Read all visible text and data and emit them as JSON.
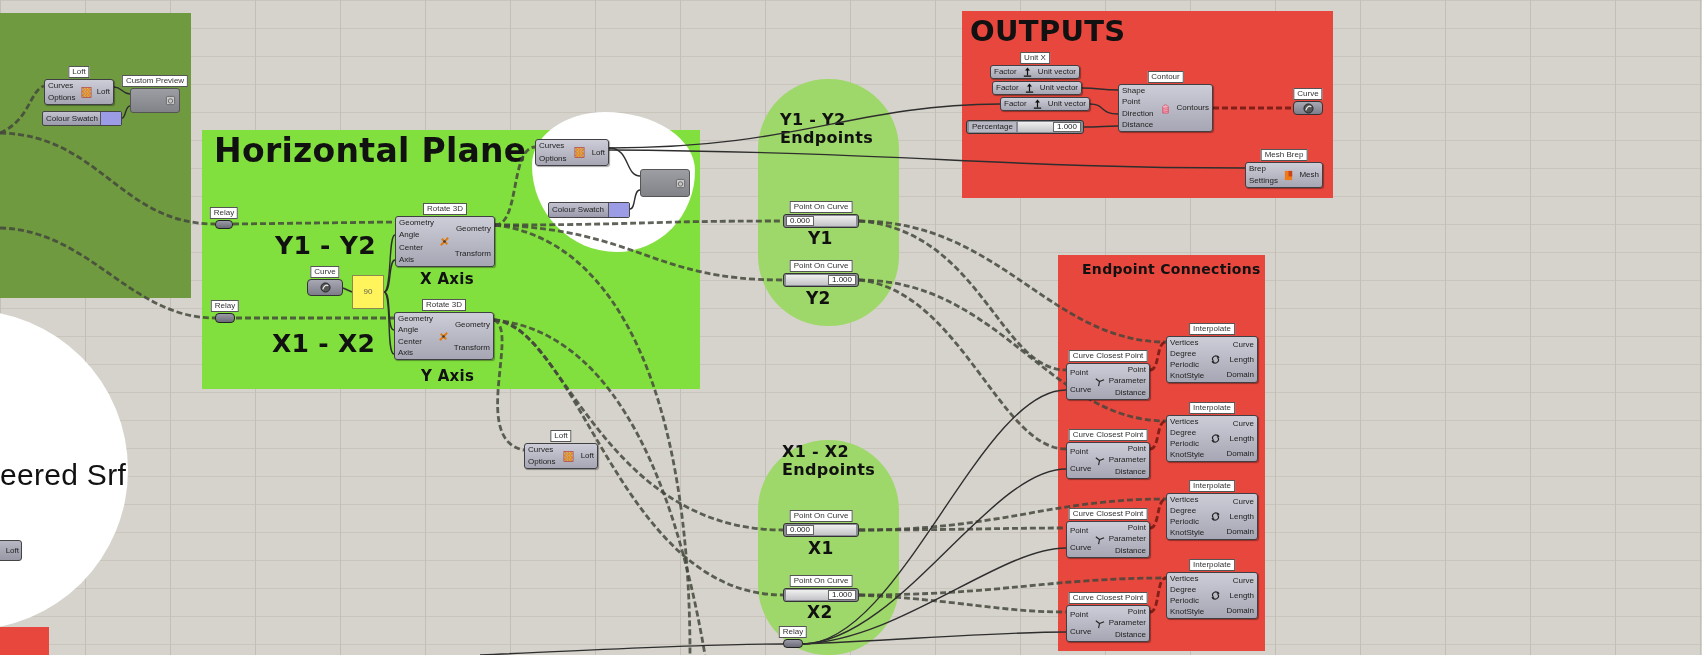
{
  "groups": [
    {
      "kind": "rect",
      "color": "#6f9a40"
    },
    {
      "kind": "rect",
      "title": "Horizontal Plane",
      "color": "#82e03e",
      "texts": [
        "Y1 - Y2",
        "X Axis",
        "X1 - X2",
        "Y Axis"
      ]
    },
    {
      "kind": "blob",
      "color": "#ffffff"
    },
    {
      "kind": "pill",
      "title": "Y1 - Y2 Endpoints",
      "color": "#9fd86a",
      "texts": [
        "Y1",
        "Y2"
      ]
    },
    {
      "kind": "rect",
      "title": "OUTPUTS",
      "color": "#e8473d"
    },
    {
      "kind": "rect",
      "title": "Endpoint Connections",
      "color": "#e8473d"
    },
    {
      "kind": "circle",
      "title": "eered Srf",
      "color": "#ffffff"
    },
    {
      "kind": "pill",
      "title": "X1 - X2 Endpoints",
      "color": "#9fd86a",
      "texts": [
        "X1",
        "X2"
      ]
    },
    {
      "kind": "rect",
      "color": "#e8473d"
    }
  ],
  "nodes": [
    {
      "kind": "component",
      "label": "Loft",
      "inputs": [
        "Curves",
        "Options"
      ],
      "outputs": [
        "Loft"
      ]
    },
    {
      "kind": "preview",
      "label": "Custom Preview"
    },
    {
      "kind": "swatch",
      "text": "Colour Swatch"
    },
    {
      "kind": "relay",
      "label": "Relay"
    },
    {
      "kind": "component",
      "label": "Rotate 3D",
      "inputs": [
        "Geometry",
        "Angle",
        "Center",
        "Axis"
      ],
      "outputs": [
        "Geometry",
        "Transform"
      ]
    },
    {
      "kind": "param",
      "label": "Curve"
    },
    {
      "kind": "panel",
      "text": "90"
    },
    {
      "kind": "relay",
      "label": "Relay"
    },
    {
      "kind": "component",
      "label": "Rotate 3D",
      "inputs": [
        "Geometry",
        "Angle",
        "Center",
        "Axis"
      ],
      "outputs": [
        "Geometry",
        "Transform"
      ]
    },
    {
      "kind": "component",
      "inputs": [
        "Curves",
        "Options"
      ],
      "outputs": [
        "Loft"
      ]
    },
    {
      "kind": "preview"
    },
    {
      "kind": "swatch",
      "text": "Colour Swatch"
    },
    {
      "kind": "slider",
      "label": "Point On Curve",
      "value": "0.000"
    },
    {
      "kind": "slider",
      "label": "Point On Curve",
      "value": "1.000"
    },
    {
      "kind": "component",
      "label": "Unit X",
      "inputs": [
        "Factor"
      ],
      "outputs": [
        "Unit vector"
      ]
    },
    {
      "kind": "component",
      "inputs": [
        "Factor"
      ],
      "outputs": [
        "Unit vector"
      ]
    },
    {
      "kind": "component",
      "inputs": [
        "Factor"
      ],
      "outputs": [
        "Unit vector"
      ]
    },
    {
      "kind": "slider",
      "name": "Percentage",
      "value": "1.000"
    },
    {
      "kind": "component",
      "label": "Contour",
      "inputs": [
        "Shape",
        "Point",
        "Direction",
        "Distance"
      ],
      "outputs": [
        "Contours"
      ]
    },
    {
      "kind": "param",
      "label": "Curve"
    },
    {
      "kind": "component",
      "label": "Mesh Brep",
      "inputs": [
        "Brep",
        "Settings"
      ],
      "outputs": [
        "Mesh"
      ]
    },
    {
      "kind": "component",
      "label": "Loft",
      "inputs": [
        "Curves",
        "Options"
      ],
      "outputs": [
        "Loft"
      ]
    },
    {
      "kind": "component",
      "label": "Interpolate",
      "inputs": [
        "Vertices",
        "Degree",
        "Periodic",
        "KnotStyle"
      ],
      "outputs": [
        "Curve",
        "Length",
        "Domain"
      ]
    },
    {
      "kind": "component",
      "label": "Curve Closest Point",
      "inputs": [
        "Point",
        "Curve"
      ],
      "outputs": [
        "Point",
        "Parameter",
        "Distance"
      ]
    },
    {
      "kind": "component",
      "label": "Interpolate",
      "inputs": [
        "Vertices",
        "Degree",
        "Periodic",
        "KnotStyle"
      ],
      "outputs": [
        "Curve",
        "Length",
        "Domain"
      ]
    },
    {
      "kind": "component",
      "label": "Curve Closest Point",
      "inputs": [
        "Point",
        "Curve"
      ],
      "outputs": [
        "Point",
        "Parameter",
        "Distance"
      ]
    },
    {
      "kind": "component",
      "label": "Interpolate",
      "inputs": [
        "Vertices",
        "Degree",
        "Periodic",
        "KnotStyle"
      ],
      "outputs": [
        "Curve",
        "Length",
        "Domain"
      ]
    },
    {
      "kind": "component",
      "label": "Curve Closest Point",
      "inputs": [
        "Point",
        "Curve"
      ],
      "outputs": [
        "Point",
        "Parameter",
        "Distance"
      ]
    },
    {
      "kind": "component",
      "label": "Interpolate",
      "inputs": [
        "Vertices",
        "Degree",
        "Periodic",
        "KnotStyle"
      ],
      "outputs": [
        "Curve",
        "Length",
        "Domain"
      ]
    },
    {
      "kind": "component",
      "label": "Curve Closest Point",
      "inputs": [
        "Point",
        "Curve"
      ],
      "outputs": [
        "Point",
        "Parameter",
        "Distance"
      ]
    },
    {
      "kind": "slider",
      "label": "Point On Curve",
      "value": "0.000"
    },
    {
      "kind": "slider",
      "label": "Point On Curve",
      "value": "1.000"
    },
    {
      "kind": "relay",
      "label": "Relay"
    },
    {
      "kind": "stub",
      "text": "Loft"
    }
  ]
}
